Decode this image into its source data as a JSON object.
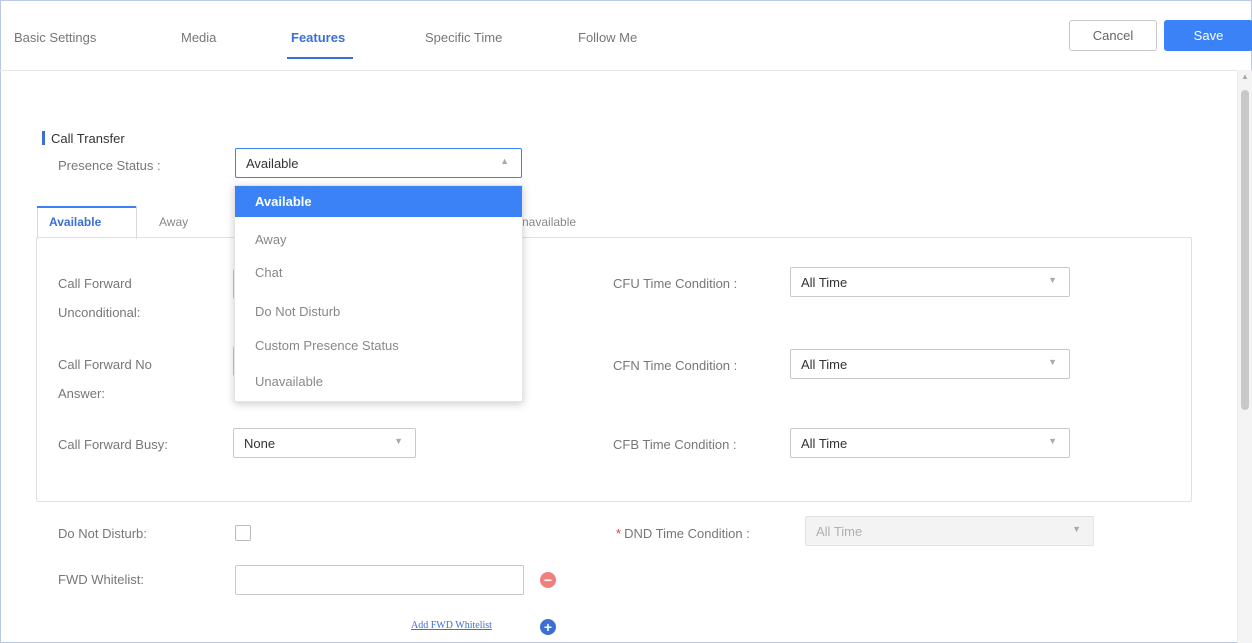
{
  "top_tabs": [
    "Basic Settings",
    "Media",
    "Features",
    "Specific Time",
    "Follow Me"
  ],
  "buttons": {
    "cancel": "Cancel",
    "save": "Save"
  },
  "section_title": "Call Transfer",
  "presence": {
    "label": "Presence Status :",
    "value": "Available",
    "options": [
      "Available",
      "Away",
      "Chat",
      "Do Not Disturb",
      "Custom Presence Status",
      "Unavailable"
    ]
  },
  "presence_tabs": {
    "available": "Available",
    "away": "Away",
    "unavailable_partial": "navailable"
  },
  "fields": {
    "cfu_label_1": "Call Forward",
    "cfu_label_2": "Unconditional:",
    "cfn_label_1": "Call Forward No",
    "cfn_label_2": "Answer:",
    "cfb_label": "Call Forward Busy:",
    "cfb_value": "None",
    "cfu_time_label": "CFU Time Condition :",
    "cfu_time_value": "All Time",
    "cfn_time_label": "CFN Time Condition :",
    "cfn_time_value": "All Time",
    "cfb_time_label": "CFB Time Condition :",
    "cfb_time_value": "All Time",
    "dnd_label": "Do Not Disturb:",
    "dnd_time_label": "DND Time Condition :",
    "dnd_time_value": "All Time",
    "fwd_whitelist_label": "FWD Whitelist:",
    "add_fwd_whitelist": "Add FWD Whitelist"
  },
  "icons": {
    "remove": "minus-circle-icon",
    "add": "plus-circle-icon",
    "arrow": "chevron-down-icon"
  },
  "colors": {
    "accent": "#3b82f6",
    "tab_active": "#3b6fd6",
    "remove": "#f08080"
  }
}
